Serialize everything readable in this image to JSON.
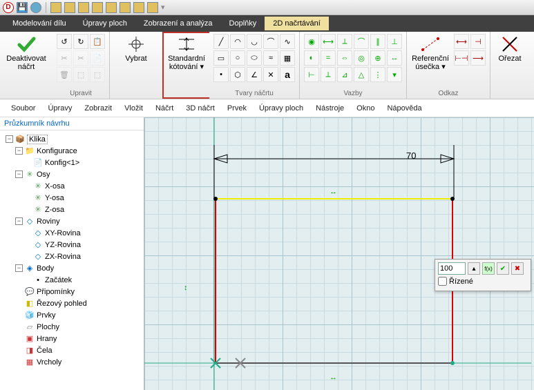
{
  "menubar": {
    "items": [
      "Modelování dílu",
      "Úpravy ploch",
      "Zobrazení a analýza",
      "Doplňky",
      "2D načrtávání"
    ],
    "active": 4
  },
  "ribbon": {
    "deactivate": "Deaktivovat náčrt",
    "edit_label": "Upravit",
    "select": "Vybrat",
    "dim": "Standardní kótování ▾",
    "shapes_label": "Tvary náčrtu",
    "bonds_label": "Vazby",
    "refline": "Referenční úsečka ▾",
    "ref_label": "Odkaz",
    "trim": "Ořezat"
  },
  "menu2": [
    "Soubor",
    "Úpravy",
    "Zobrazit",
    "Vložit",
    "Náčrt",
    "3D náčrt",
    "Prvek",
    "Úpravy ploch",
    "Nástroje",
    "Okno",
    "Nápověda"
  ],
  "explorer": {
    "title": "Průzkumník návrhu",
    "root": "Klika",
    "cfg_head": "Konfigurace",
    "cfg_item": "Konfig<1>",
    "axes_head": "Osy",
    "axes": [
      "X-osa",
      "Y-osa",
      "Z-osa"
    ],
    "planes_head": "Roviny",
    "planes": [
      "XY-Rovina",
      "YZ-Rovina",
      "ZX-Rovina"
    ],
    "bodies_head": "Body",
    "body_item": "Začátek",
    "pripominky": "Připomínky",
    "rez": "Řezový pohled",
    "prvky": "Prvky",
    "plochy": "Plochy",
    "hrany": "Hrany",
    "cela": "Čela",
    "vrcholy": "Vrcholy"
  },
  "sketch": {
    "dim_value": "70"
  },
  "dimpanel": {
    "value": "100",
    "driven": "Řízené"
  }
}
